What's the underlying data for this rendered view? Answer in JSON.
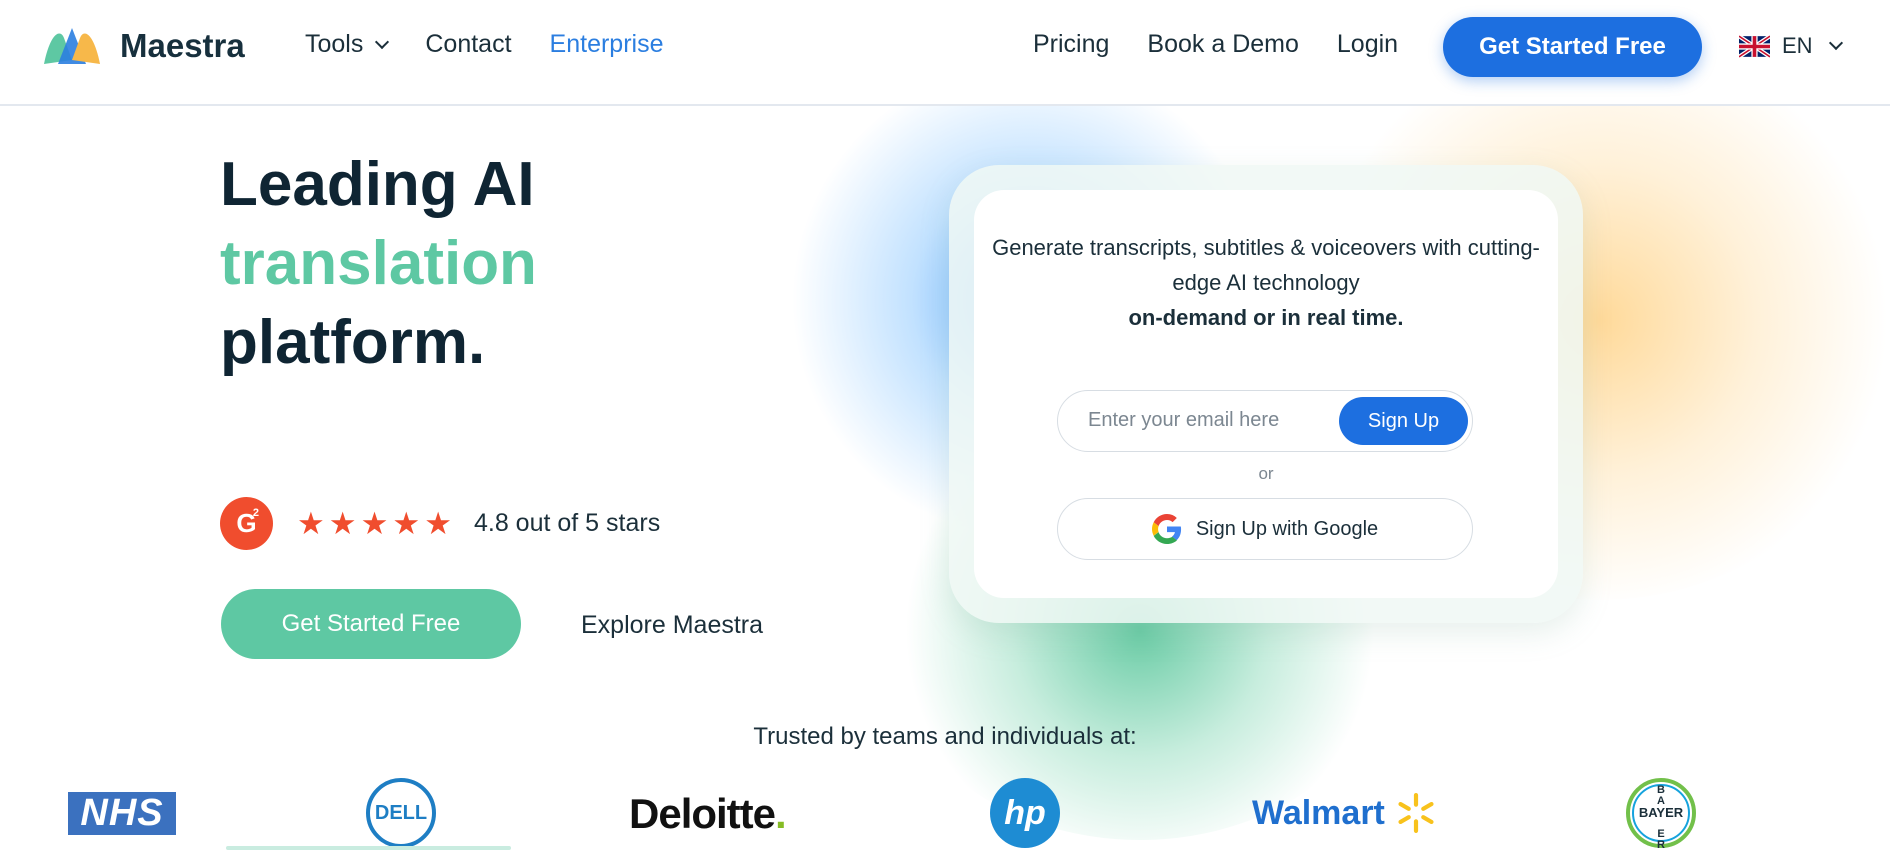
{
  "header": {
    "brand": "Maestra",
    "nav_left": [
      {
        "label": "Tools",
        "has_dropdown": true,
        "active": false
      },
      {
        "label": "Contact",
        "has_dropdown": false,
        "active": false
      },
      {
        "label": "Enterprise",
        "has_dropdown": false,
        "active": true
      }
    ],
    "nav_right": [
      {
        "label": "Pricing"
      },
      {
        "label": "Book a Demo"
      },
      {
        "label": "Login"
      }
    ],
    "cta_label": "Get Started Free",
    "language": "EN",
    "language_flag_icon": "uk-flag-icon"
  },
  "hero": {
    "title_line1": "Leading AI",
    "title_line2": "translation",
    "title_line3": "platform.",
    "rating": {
      "badge_icon": "g2-icon",
      "stars": 5,
      "text": "4.8 out of 5 stars"
    },
    "cta_label": "Get Started Free",
    "secondary_label": "Explore Maestra"
  },
  "signup": {
    "description": "Generate transcripts, subtitles & voiceovers with cutting-edge AI technology",
    "description_bold": "on-demand or in real time.",
    "email_placeholder": "Enter your email here",
    "email_value": "",
    "signup_label": "Sign Up",
    "or_label": "or",
    "google_label": "Sign Up with Google"
  },
  "trusted": {
    "text": "Trusted by teams and individuals at:",
    "logos": [
      "NHS",
      "DELL",
      "Deloitte",
      "hp",
      "Walmart",
      "BAYER"
    ]
  },
  "colors": {
    "primary_blue": "#1d6fe0",
    "accent_green": "#5ec8a3",
    "g2_red": "#f04d2e",
    "text_dark": "#0f2533",
    "link_blue": "#2b7ee0"
  }
}
